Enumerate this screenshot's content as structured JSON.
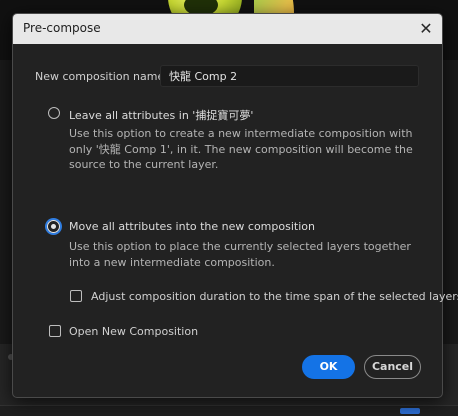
{
  "dialog": {
    "title": "Pre-compose",
    "close_icon": "close-icon",
    "name_label": "New composition name:",
    "name_value": "快龍 Comp 2",
    "options": [
      {
        "label": "Leave all attributes in '捕捉寶可夢'",
        "description": "Use this option to create a new intermediate composition with only '快龍 Comp 1', in it. The new composition will become the source to the current layer.",
        "selected": false
      },
      {
        "label": "Move all attributes into the new composition",
        "description": "Use this option to place the currently selected layers together into a new intermediate composition.",
        "selected": true
      }
    ],
    "adjust_duration_label": "Adjust composition duration to the time span of the selected layers",
    "adjust_duration_checked": false,
    "open_new_label": "Open New Composition",
    "open_new_checked": false,
    "ok_label": "OK",
    "cancel_label": "Cancel"
  },
  "colors": {
    "accent": "#1473e6",
    "dialog_bg": "#222222",
    "titlebar_bg": "#e8e8e8"
  }
}
